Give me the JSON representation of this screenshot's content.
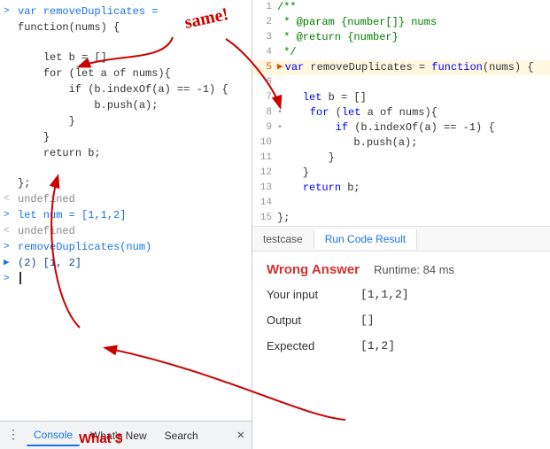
{
  "annotation": {
    "same_text": "same!",
    "what_text": "What $"
  },
  "left_panel": {
    "lines": [
      {
        "prompt": ">",
        "prompt_type": "blue",
        "text": "var removeDuplicates =",
        "indent": 0
      },
      {
        "prompt": "",
        "prompt_type": "",
        "text": "function(nums) {",
        "indent": 1
      },
      {
        "prompt": "",
        "prompt_type": "",
        "text": "",
        "indent": 0
      },
      {
        "prompt": "",
        "prompt_type": "",
        "text": "    let b = []",
        "indent": 1
      },
      {
        "prompt": "",
        "prompt_type": "",
        "text": "    for (let a of nums){",
        "indent": 1
      },
      {
        "prompt": "",
        "prompt_type": "",
        "text": "        if (b.indexOf(a) == -1) {",
        "indent": 1
      },
      {
        "prompt": "",
        "prompt_type": "",
        "text": "            b.push(a);",
        "indent": 1
      },
      {
        "prompt": "",
        "prompt_type": "",
        "text": "        }",
        "indent": 1
      },
      {
        "prompt": "",
        "prompt_type": "",
        "text": "    }",
        "indent": 1
      },
      {
        "prompt": "",
        "prompt_type": "",
        "text": "    return b;",
        "indent": 1
      },
      {
        "prompt": "",
        "prompt_type": "",
        "text": "",
        "indent": 0
      },
      {
        "prompt": "",
        "prompt_type": "",
        "text": "};",
        "indent": 0
      },
      {
        "prompt": "<",
        "prompt_type": "gray",
        "text": "undefined",
        "indent": 0
      },
      {
        "prompt": ">",
        "prompt_type": "blue",
        "text": "let num = [1,1,2]",
        "indent": 0
      },
      {
        "prompt": "<",
        "prompt_type": "gray",
        "text": "undefined",
        "indent": 0
      },
      {
        "prompt": ">",
        "prompt_type": "blue",
        "text": "removeDuplicates(num)",
        "indent": 0
      },
      {
        "prompt": ">",
        "prompt_type": "blue",
        "text": "(2) [1, 2]",
        "indent": 0,
        "has_arrow": true
      },
      {
        "prompt": ">",
        "prompt_type": "blue",
        "text": "",
        "indent": 0,
        "has_cursor": true
      }
    ],
    "bottom_bar": {
      "dots": "⋮",
      "tabs": [
        "Console",
        "What's New",
        "Search"
      ],
      "active_tab": "Console",
      "close": "✕"
    }
  },
  "right_panel": {
    "code_lines": [
      {
        "num": "1",
        "code": "/**"
      },
      {
        "num": "2",
        "code": " * @param {number[]} nums"
      },
      {
        "num": "3",
        "code": " * @return {number}"
      },
      {
        "num": "4",
        "code": " */"
      },
      {
        "num": "5",
        "code": "var removeDuplicates = function(nums) {",
        "has_arrow": true
      },
      {
        "num": "6",
        "code": ""
      },
      {
        "num": "7",
        "code": "    let b = []"
      },
      {
        "num": "8",
        "code": "    for (let a of nums){",
        "has_dot": true
      },
      {
        "num": "9",
        "code": "        if (b.indexOf(a) == -1) {",
        "has_dot": true
      },
      {
        "num": "10",
        "code": "            b.push(a);"
      },
      {
        "num": "11",
        "code": "        }"
      },
      {
        "num": "12",
        "code": "    }"
      },
      {
        "num": "13",
        "code": "    return b;"
      },
      {
        "num": "14",
        "code": ""
      },
      {
        "num": "15",
        "code": "};"
      }
    ],
    "tabs": [
      {
        "label": "testcase",
        "active": false
      },
      {
        "label": "Run Code Result",
        "active": true
      }
    ],
    "results": {
      "status": "Wrong Answer",
      "runtime": "Runtime: 84 ms",
      "rows": [
        {
          "label": "Your input",
          "value": "[1,1,2]"
        },
        {
          "label": "Output",
          "value": "[]"
        },
        {
          "label": "Expected",
          "value": "[1,2]"
        }
      ]
    }
  }
}
